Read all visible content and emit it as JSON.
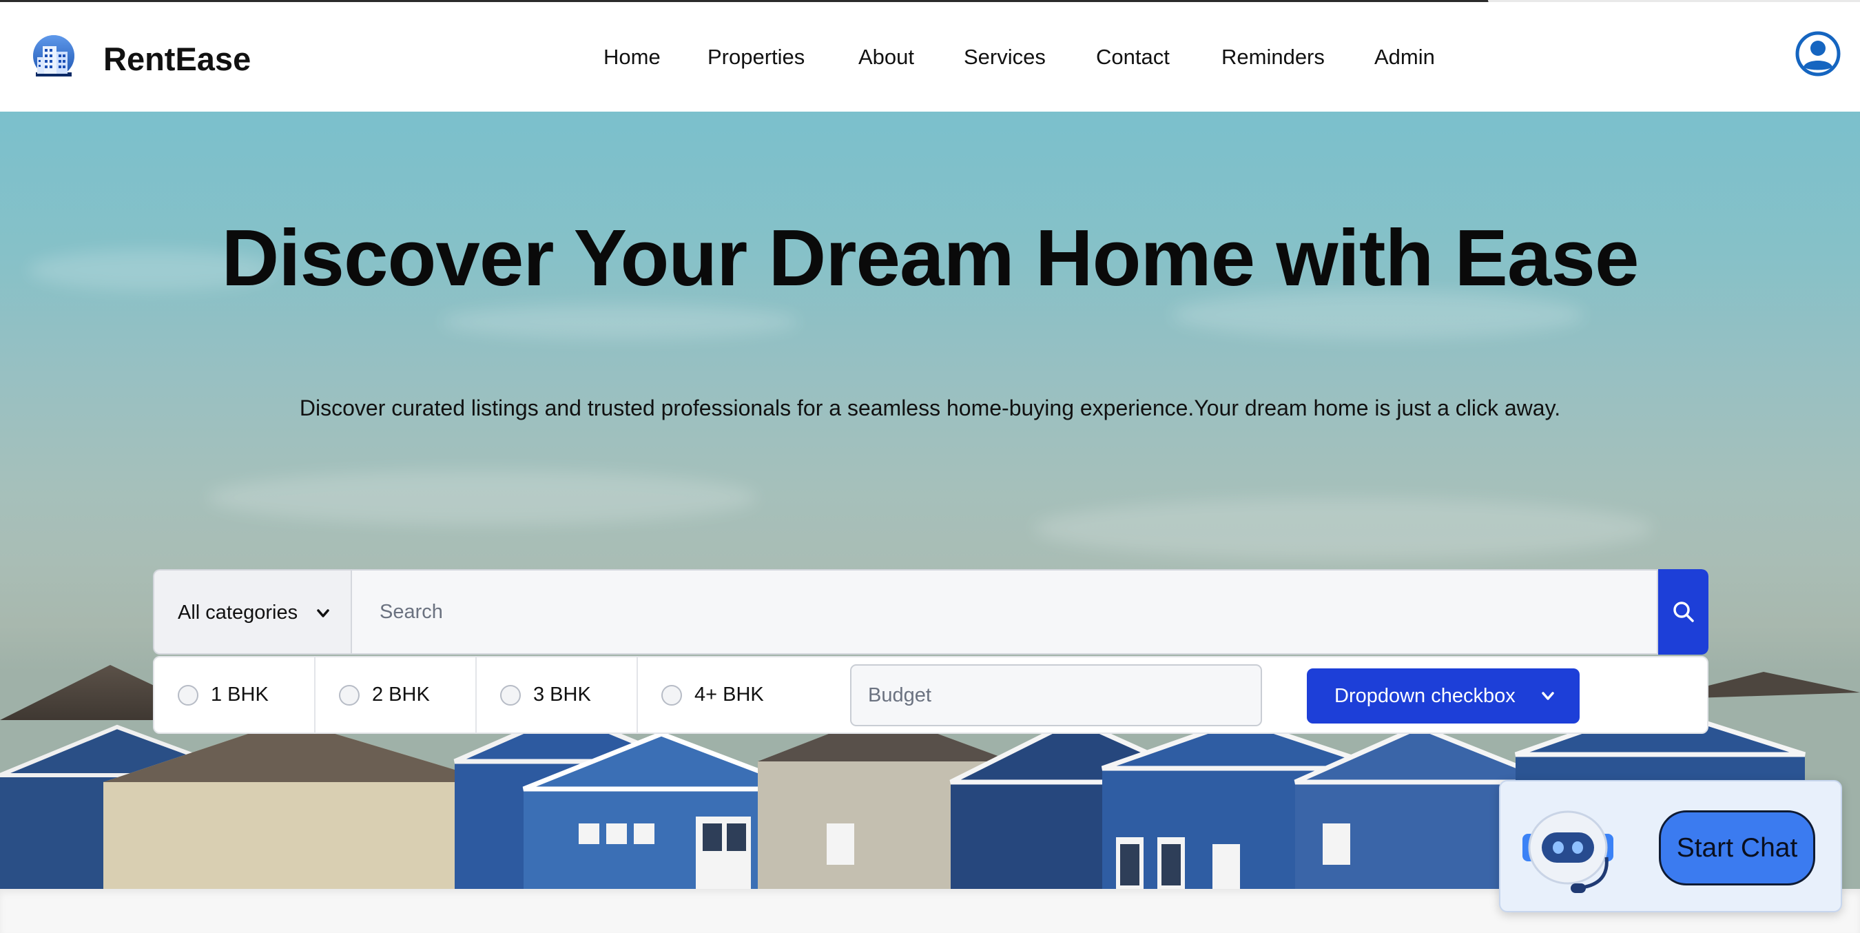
{
  "header": {
    "brand": "RentEase",
    "nav": [
      {
        "label": "Home"
      },
      {
        "label": "Properties"
      },
      {
        "label": "About"
      },
      {
        "label": "Services"
      },
      {
        "label": "Contact"
      },
      {
        "label": "Reminders"
      },
      {
        "label": "Admin"
      }
    ],
    "logo_icon": "building-logo-icon",
    "user_icon": "user-account-icon"
  },
  "hero": {
    "title": "Discover Your Dream Home with Ease",
    "subtitle": "Discover curated listings and trusted professionals for a seamless home-buying experience.Your dream home is just a click away."
  },
  "search": {
    "category_label": "All categories",
    "placeholder": "Search",
    "search_icon": "search-icon"
  },
  "filters": {
    "bhk_options": [
      {
        "label": "1 BHK",
        "checked": false
      },
      {
        "label": "2 BHK",
        "checked": false
      },
      {
        "label": "3 BHK",
        "checked": false
      },
      {
        "label": "4+ BHK",
        "checked": false
      }
    ],
    "budget_placeholder": "Budget",
    "dropdown_label": "Dropdown checkbox"
  },
  "chat": {
    "button_label": "Start Chat",
    "bot_icon": "robot-assistant-icon"
  },
  "colors": {
    "accent": "#1d3fd8",
    "chat_button": "#3b7bf0",
    "user_icon": "#1565c0"
  }
}
